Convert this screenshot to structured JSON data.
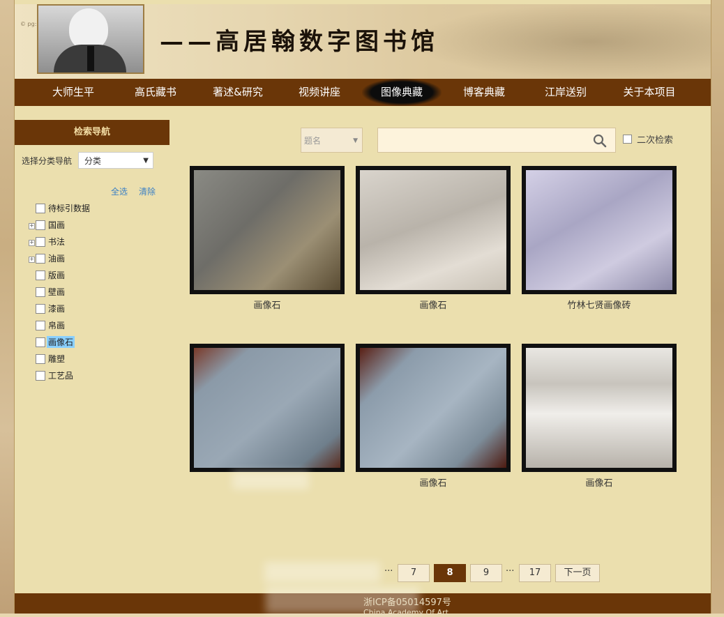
{
  "banner": {
    "title": "——高居翰数字图书馆",
    "small": "© pg: lv"
  },
  "nav": {
    "items": [
      "大师生平",
      "高氏藏书",
      "著述&研究",
      "视频讲座",
      "图像典藏",
      "博客典藏",
      "江岸送别",
      "关于本项目"
    ],
    "active": "图像典藏"
  },
  "sidebar": {
    "heading": "检索导航",
    "category_label": "选择分类导航",
    "category_value": "分类",
    "select_all": "全选",
    "clear": "清除",
    "items": [
      {
        "label": "待标引数据",
        "expandable": false
      },
      {
        "label": "国画",
        "expandable": true
      },
      {
        "label": "书法",
        "expandable": true
      },
      {
        "label": "油画",
        "expandable": true
      },
      {
        "label": "版画",
        "expandable": false
      },
      {
        "label": "壁画",
        "expandable": false
      },
      {
        "label": "漆画",
        "expandable": false
      },
      {
        "label": "帛画",
        "expandable": false
      },
      {
        "label": "画像石",
        "expandable": false,
        "selected": true
      },
      {
        "label": "雕塑",
        "expandable": false
      },
      {
        "label": "工艺品",
        "expandable": false
      }
    ]
  },
  "search": {
    "field_placeholder": "题名",
    "query": "",
    "secondary_label": "二次检索"
  },
  "results": [
    {
      "caption": "画像石"
    },
    {
      "caption": "画像石"
    },
    {
      "caption": "竹林七贤画像砖"
    },
    {
      "caption": ""
    },
    {
      "caption": "画像石"
    },
    {
      "caption": "画像石"
    }
  ],
  "pagination": {
    "pages": [
      "7",
      "8",
      "9",
      "17"
    ],
    "current": "8",
    "ellipsis": "···",
    "next": "下一页"
  },
  "footer": {
    "line1": "浙ICP备05014597号",
    "line2": "China Academy Of Art"
  },
  "colors": {
    "nav_bg": "#6a3608",
    "page_bg": "#ebdfae",
    "link": "#3a7fc5"
  }
}
